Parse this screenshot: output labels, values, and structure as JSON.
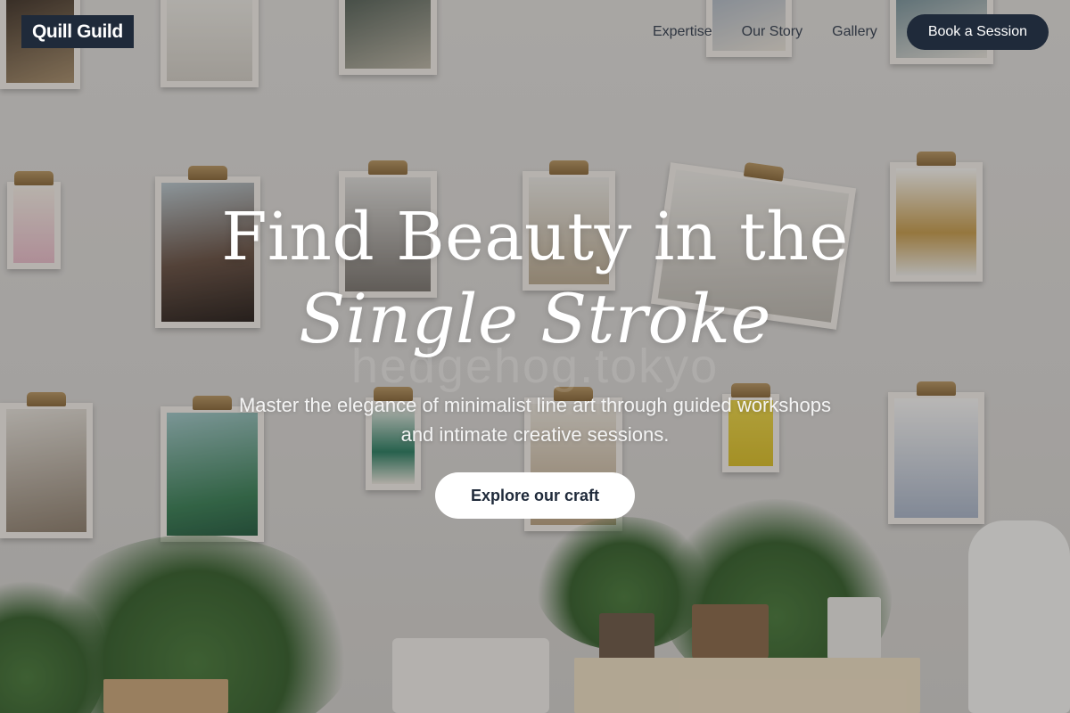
{
  "header": {
    "brand": "Quill Guild",
    "nav": [
      {
        "label": "Expertise"
      },
      {
        "label": "Our Story"
      },
      {
        "label": "Gallery"
      }
    ],
    "cta_label": "Book a Session"
  },
  "hero": {
    "title_line1": "Find Beauty in the",
    "title_line2": "Single Stroke",
    "watermark": "hedgehog.tokyo",
    "subtitle": "Master the elegance of minimalist line art through guided workshops and intimate creative sessions.",
    "cta_label": "Explore our craft"
  },
  "colors": {
    "brand_navy": "#1f2a3a",
    "text_white": "#ffffff",
    "nav_text": "#2f3641"
  }
}
